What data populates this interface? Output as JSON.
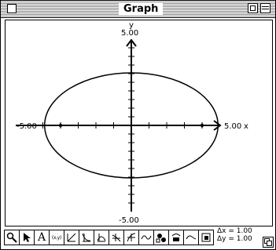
{
  "window": {
    "title": "Graph"
  },
  "graph": {
    "y_axis_label": "y",
    "x_axis_label": "x",
    "y_max_label": "5.00",
    "y_min_label": "-5.00",
    "x_min_label": "-5.00",
    "x_max_label": "5.00",
    "curve": {
      "shape": "ellipse",
      "semi_axis_x": 4.9,
      "semi_axis_y": 2.9
    },
    "foci_markers": [
      -4.0,
      4.0
    ]
  },
  "status": {
    "dx": "Δx = 1.00",
    "dy": "Δy = 1.00"
  },
  "toolbar": {
    "tools": [
      "zoom-icon",
      "arrow-pointer-icon",
      "text-tool-icon",
      "coordinate-xy-icon",
      "line-tool-icon",
      "curve-tool-1-icon",
      "curve-tool-2-icon",
      "curve-tool-3-icon",
      "curve-tool-4-icon",
      "wave-tool-icon",
      "fill-tool-icon",
      "fill-tool-2-icon",
      "arc-tool-icon",
      "window-tool-icon"
    ],
    "coord_label": "(x,y)",
    "text_tool_label": "A"
  }
}
